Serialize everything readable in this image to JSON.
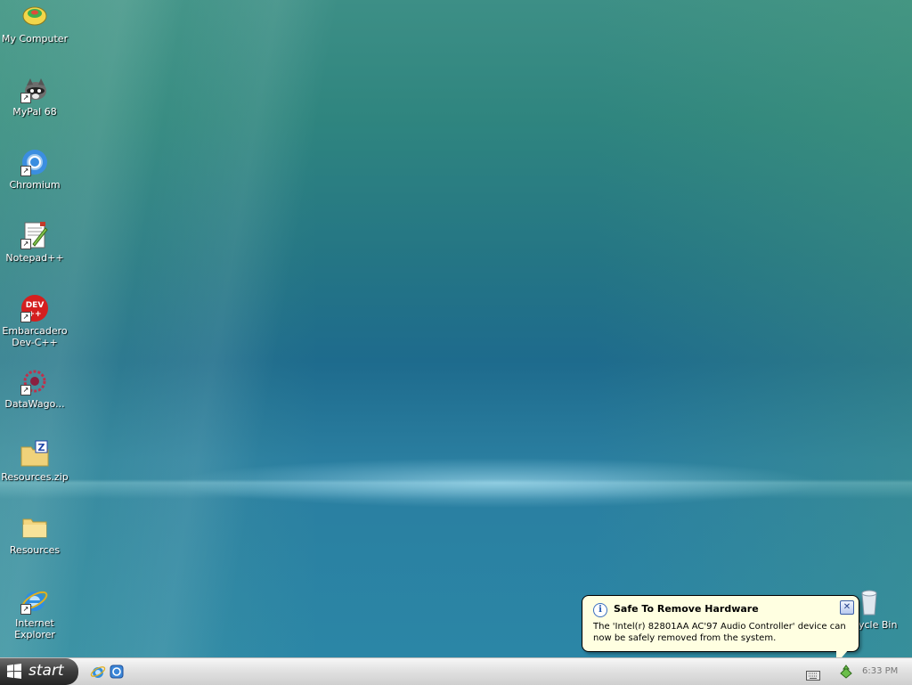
{
  "desktop": {
    "icons": [
      {
        "label": "My Computer"
      },
      {
        "label": "MyPal 68"
      },
      {
        "label": "Chromium"
      },
      {
        "label": "Notepad++"
      },
      {
        "label": "Embarcadero Dev-C++",
        "line1": "Embarcadero",
        "line2": "Dev-C++"
      },
      {
        "label": "DataWago..."
      },
      {
        "label": "Resources.zip"
      },
      {
        "label": "Resources"
      },
      {
        "label": "Internet Explorer",
        "line1": "Internet",
        "line2": "Explorer"
      },
      {
        "label": "ycle Bin"
      }
    ]
  },
  "balloon": {
    "title": "Safe To Remove Hardware",
    "message": "The 'Intel(r) 82801AA AC'97 Audio Controller' device can now be safely removed from the system.",
    "close_label": "✕"
  },
  "taskbar": {
    "start_label": "start",
    "clock": "6:33 PM"
  },
  "colors": {
    "balloon_bg": "#ffffe1",
    "start_button": "#3c3c3c",
    "taskbar": "#e2e2e2"
  }
}
